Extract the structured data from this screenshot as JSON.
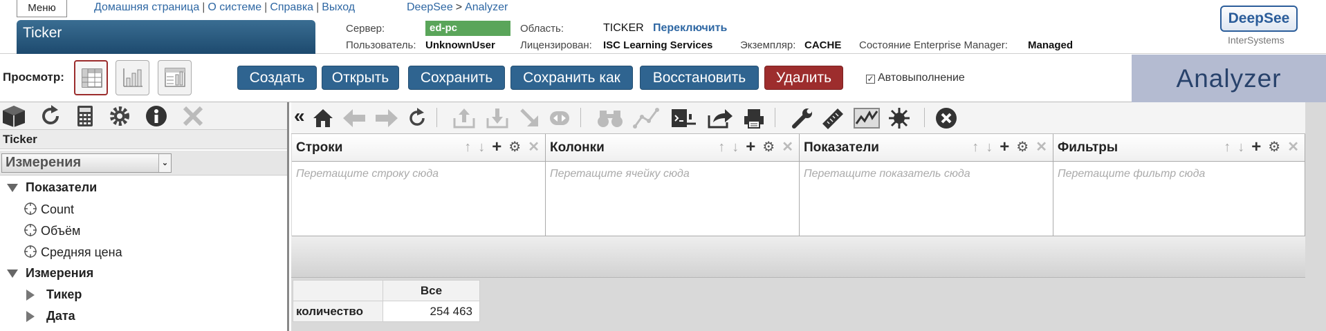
{
  "header": {
    "menu_label": "Меню",
    "links": [
      "Домашняя страница",
      "О системе",
      "Справка",
      "Выход"
    ],
    "breadcrumb": [
      "DeepSee",
      "Analyzer"
    ],
    "title": "Ticker",
    "server_label": "Сервер:",
    "server_value": "ed-pc",
    "namespace_label": "Область:",
    "namespace_value": "TICKER",
    "switch_label": "Переключить",
    "user_label": "Пользователь:",
    "user_value": "UnknownUser",
    "license_label": "Лицензирован:",
    "license_value": "ISC Learning Services",
    "instance_label": "Экземпляр:",
    "instance_value": "CACHE",
    "em_label": "Состояние Enterprise Manager:",
    "em_value": "Managed",
    "logo": "DeepSee",
    "logo_sub": "InterSystems"
  },
  "toolbar": {
    "view_label": "Просмотр:",
    "buttons": [
      "Создать",
      "Открыть",
      "Сохранить",
      "Сохранить как",
      "Восстановить",
      "Удалить"
    ],
    "auto_run_label": "Автовыполнение",
    "auto_run_checked": true,
    "panel_title": "Analyzer"
  },
  "left": {
    "title": "Ticker",
    "select_value": "Измерения",
    "tree": {
      "measures_label": "Показатели",
      "measures": [
        "Count",
        "Объём",
        "Средняя цена"
      ],
      "dimensions_label": "Измерения",
      "dimensions": [
        "Тикер",
        "Дата"
      ]
    }
  },
  "shelves": [
    {
      "title": "Строки",
      "placeholder": "Перетащите строку сюда"
    },
    {
      "title": "Колонки",
      "placeholder": "Перетащите ячейку сюда"
    },
    {
      "title": "Показатели",
      "placeholder": "Перетащите показатель сюда"
    },
    {
      "title": "Фильтры",
      "placeholder": "Перетащите фильтр сюда"
    }
  ],
  "pivot": {
    "column_header": "Все",
    "row_header": "количество",
    "value": "254 463"
  },
  "colors": {
    "accent": "#2f6490",
    "danger": "#9d2d2d",
    "server_badge": "#5aa55a",
    "analyzer_panel": "#b4bbd1"
  }
}
